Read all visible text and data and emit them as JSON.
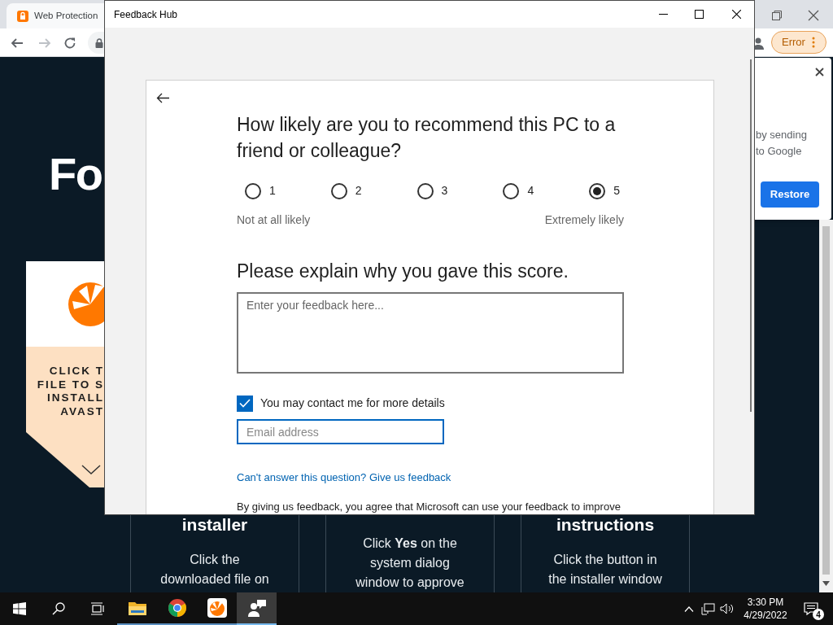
{
  "browser": {
    "tab_title": "Web Protection",
    "error_button": "Error"
  },
  "page": {
    "heading": "Fo",
    "card_lines": [
      "CLICK T",
      "FILE TO S",
      "INSTALL",
      "AVAST"
    ],
    "steps": [
      {
        "title": "installer",
        "text": "Click the downloaded file on"
      },
      {
        "text": "Click **Yes** on the system dialog window to approve"
      },
      {
        "title": "instructions",
        "text": "Click the button in the installer window"
      }
    ]
  },
  "popup": {
    "lines": [
      "by sending",
      "to Google"
    ],
    "button": "Restore"
  },
  "feedback_window": {
    "title": "Feedback Hub",
    "question": "How likely are you to recommend this PC to a friend or colleague?",
    "ratings": [
      {
        "label": "1",
        "selected": false
      },
      {
        "label": "2",
        "selected": false
      },
      {
        "label": "3",
        "selected": false
      },
      {
        "label": "4",
        "selected": false
      },
      {
        "label": "5",
        "selected": true
      }
    ],
    "scale_low": "Not at all likely",
    "scale_high": "Extremely likely",
    "explain_heading": "Please explain why you gave this score.",
    "feedback_field": {
      "placeholder": "Enter your feedback here..."
    },
    "contact": {
      "label": "You may contact me for more details",
      "checked": true
    },
    "email_field": {
      "placeholder": "Email address"
    },
    "link": "Can't answer this question? Give us feedback",
    "consent": "By giving us feedback, you agree that Microsoft can use your feedback to improve"
  },
  "taskbar": {
    "apps": [
      {
        "kind": "explorer",
        "selected": false
      },
      {
        "kind": "chrome",
        "selected": false
      },
      {
        "kind": "avast",
        "selected": false
      },
      {
        "kind": "feedback",
        "selected": true
      }
    ],
    "time": "3:30 PM",
    "date": "4/29/2022",
    "notification_count": "4"
  }
}
